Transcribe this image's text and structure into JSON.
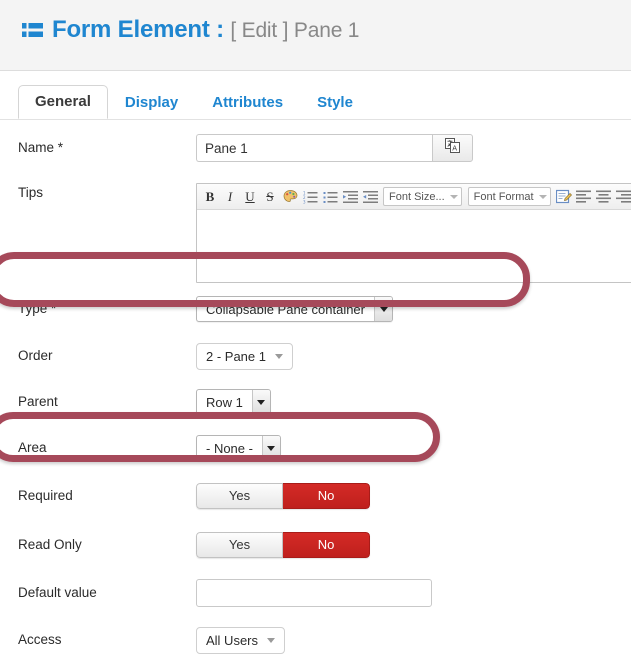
{
  "header": {
    "icon": "list-icon",
    "title": "Form Element :",
    "subtitle": "[ Edit ] Pane 1"
  },
  "tabs": [
    {
      "label": "General",
      "active": true
    },
    {
      "label": "Display",
      "active": false
    },
    {
      "label": "Attributes",
      "active": false
    },
    {
      "label": "Style",
      "active": false
    }
  ],
  "form": {
    "name": {
      "label": "Name *",
      "value": "Pane 1",
      "placeholder": "",
      "translate_button_icon": "translate-icon"
    },
    "tips": {
      "label": "Tips",
      "content": "",
      "toolbar": {
        "bold": "B",
        "italic": "I",
        "underline": "U",
        "strikethrough": "S",
        "text_color": "text-color-icon",
        "numbered_list": "numbered-list-icon",
        "bulleted_list": "bulleted-list-icon",
        "indent": "indent-icon",
        "outdent": "outdent-icon",
        "font_size": "Font Size...",
        "font_format": "Font Format",
        "source_edit": "source-edit-icon",
        "align_left": "align-left-icon",
        "align_center": "align-center-icon",
        "align_right": "align-right-icon"
      }
    },
    "type": {
      "label": "Type *",
      "value": "Collapsable Pane container"
    },
    "order": {
      "label": "Order",
      "value": "2 - Pane 1"
    },
    "parent": {
      "label": "Parent",
      "value": "Row 1"
    },
    "area": {
      "label": "Area",
      "value": "- None -"
    },
    "required": {
      "label": "Required",
      "yes": "Yes",
      "no": "No",
      "selected": "No"
    },
    "read_only": {
      "label": "Read Only",
      "yes": "Yes",
      "no": "No",
      "selected": "No"
    },
    "default_value": {
      "label": "Default value",
      "value": "",
      "placeholder": ""
    },
    "access": {
      "label": "Access",
      "value": "All Users"
    }
  },
  "colors": {
    "title_blue": "#1f86d0",
    "highlight_ring": "#a6495a",
    "toggle_active_red": "#c9302c",
    "header_bg": "#f4f4f4"
  }
}
